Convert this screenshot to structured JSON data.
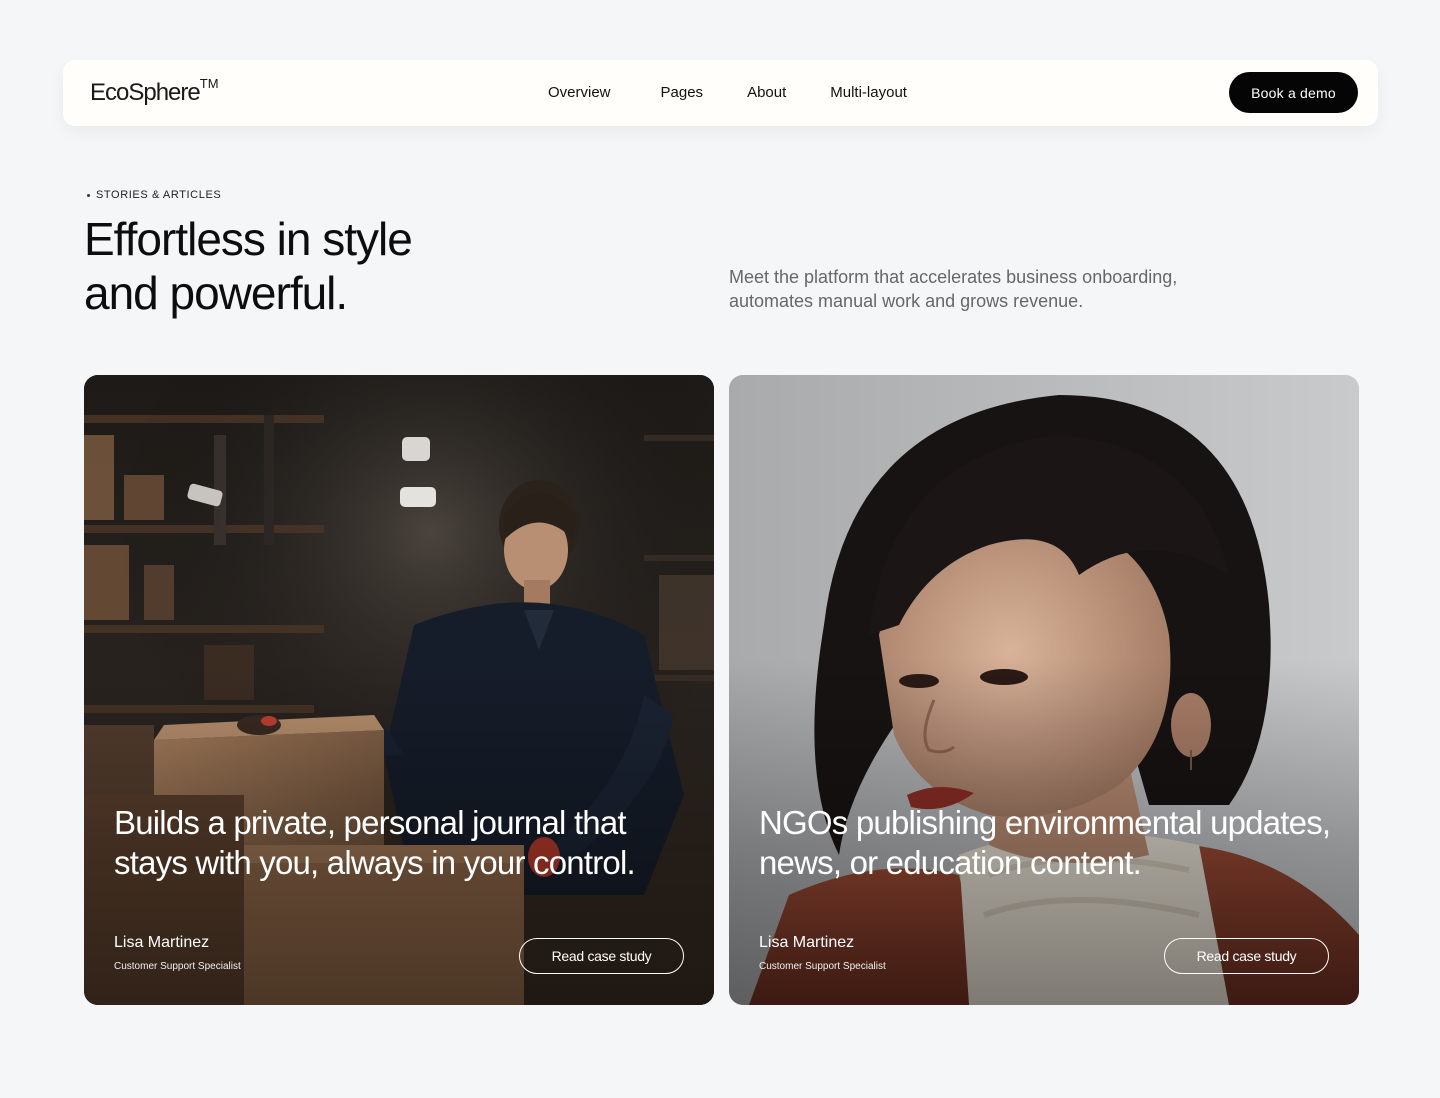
{
  "header": {
    "logo": "EcoSphere",
    "logo_mark": "TM",
    "nav": [
      {
        "label": "Overview"
      },
      {
        "label": "Pages"
      },
      {
        "label": "About"
      },
      {
        "label": "Multi-layout"
      }
    ],
    "cta_label": "Book a demo"
  },
  "intro": {
    "eyebrow": "STORIES & ARTICLES",
    "headline_line1": "Effortless in style",
    "headline_line2": "and powerful.",
    "lede": "Meet the platform that accelerates business onboarding, automates manual work and grows revenue."
  },
  "cards": [
    {
      "title": "Builds a private, personal journal that stays with you, always in your control.",
      "author": "Lisa Martinez",
      "role": "Customer Support Specialist",
      "button_label": "Read case study",
      "image": "warehouse-worker-photo"
    },
    {
      "title": "NGOs publishing environmental updates, news, or education content.",
      "author": "Lisa Martinez",
      "role": "Customer Support Specialist",
      "button_label": "Read case study",
      "image": "portrait-woman-photo"
    }
  ],
  "colors": {
    "page_bg": "#f5f6f7",
    "nav_bg": "#fffefa",
    "cta_bg": "#050505",
    "lede_text": "#676767"
  }
}
